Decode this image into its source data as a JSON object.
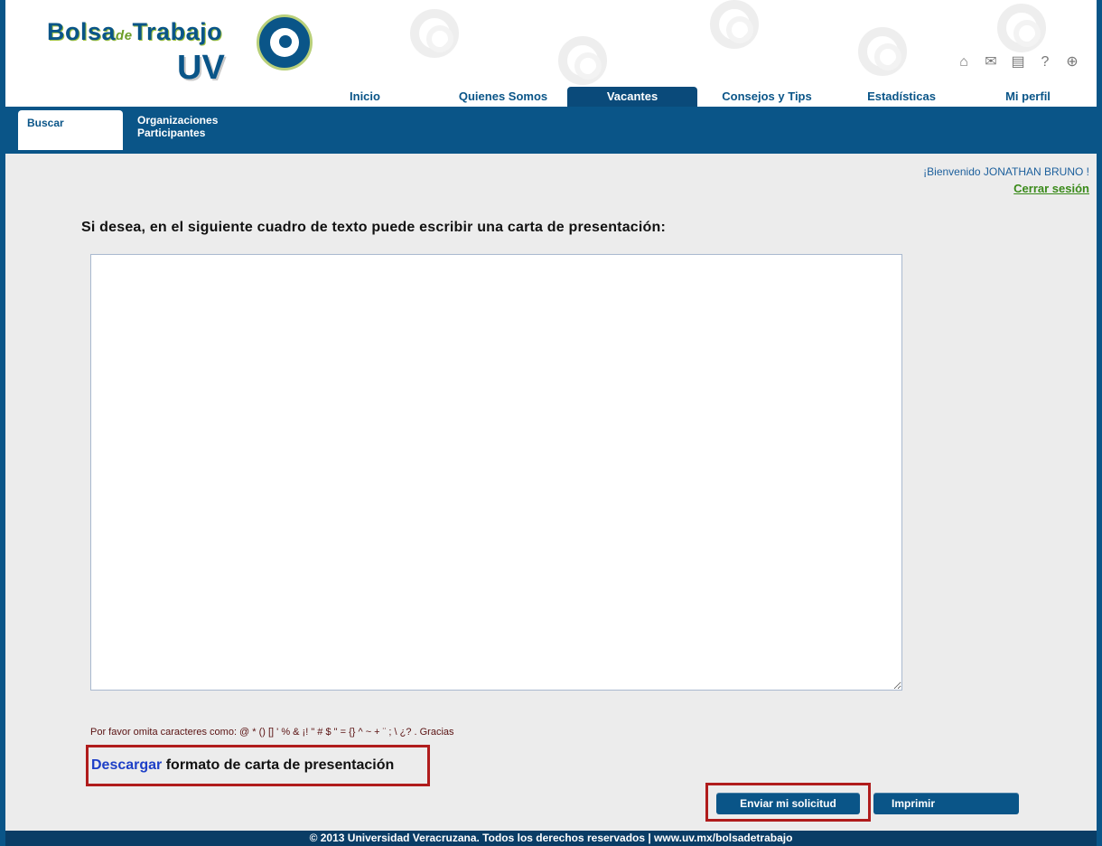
{
  "logo": {
    "brand_main_a": "Bolsa",
    "brand_small": "de",
    "brand_main_b": "Trabajo",
    "brand_uv": "UV"
  },
  "util_icons": [
    "home-icon",
    "mail-icon",
    "document-icon",
    "help-icon",
    "globe-icon"
  ],
  "main_nav": {
    "items": [
      {
        "label": "Inicio",
        "active": false
      },
      {
        "label": "Quienes Somos",
        "active": false
      },
      {
        "label": "Vacantes",
        "active": true
      },
      {
        "label": "Consejos y Tips",
        "active": false
      },
      {
        "label": "Estadísticas",
        "active": false
      },
      {
        "label": "Mi perfil",
        "active": false
      }
    ]
  },
  "sub_nav": {
    "active_tab": "Buscar",
    "tab2_line1": "Organizaciones",
    "tab2_line2": "Participantes"
  },
  "session": {
    "welcome": "¡Bienvenido JONATHAN BRUNO !",
    "logout": "Cerrar sesión"
  },
  "main": {
    "prompt": "Si desea, en el siguiente cuadro de texto puede escribir una carta de presentación:",
    "letter_value": "",
    "note": "Por favor omita caracteres como: @ * () [] ' % & ¡! \" # $ \" = {} ^ ~ + ¨ ; \\ ¿? . Gracias",
    "download_link": "Descargar",
    "download_text": " formato de carta de presentación"
  },
  "buttons": {
    "send": "Enviar mi solicitud",
    "print": "Imprimir"
  },
  "footer": {
    "text": "© 2013 Universidad Veracruzana. Todos los derechos reservados | www.uv.mx/bolsadetrabajo"
  },
  "colors": {
    "primary": "#0a5588",
    "highlight_border": "#b01c1c",
    "link_blue": "#1d3fc7",
    "logout_green": "#3a8a1a"
  }
}
